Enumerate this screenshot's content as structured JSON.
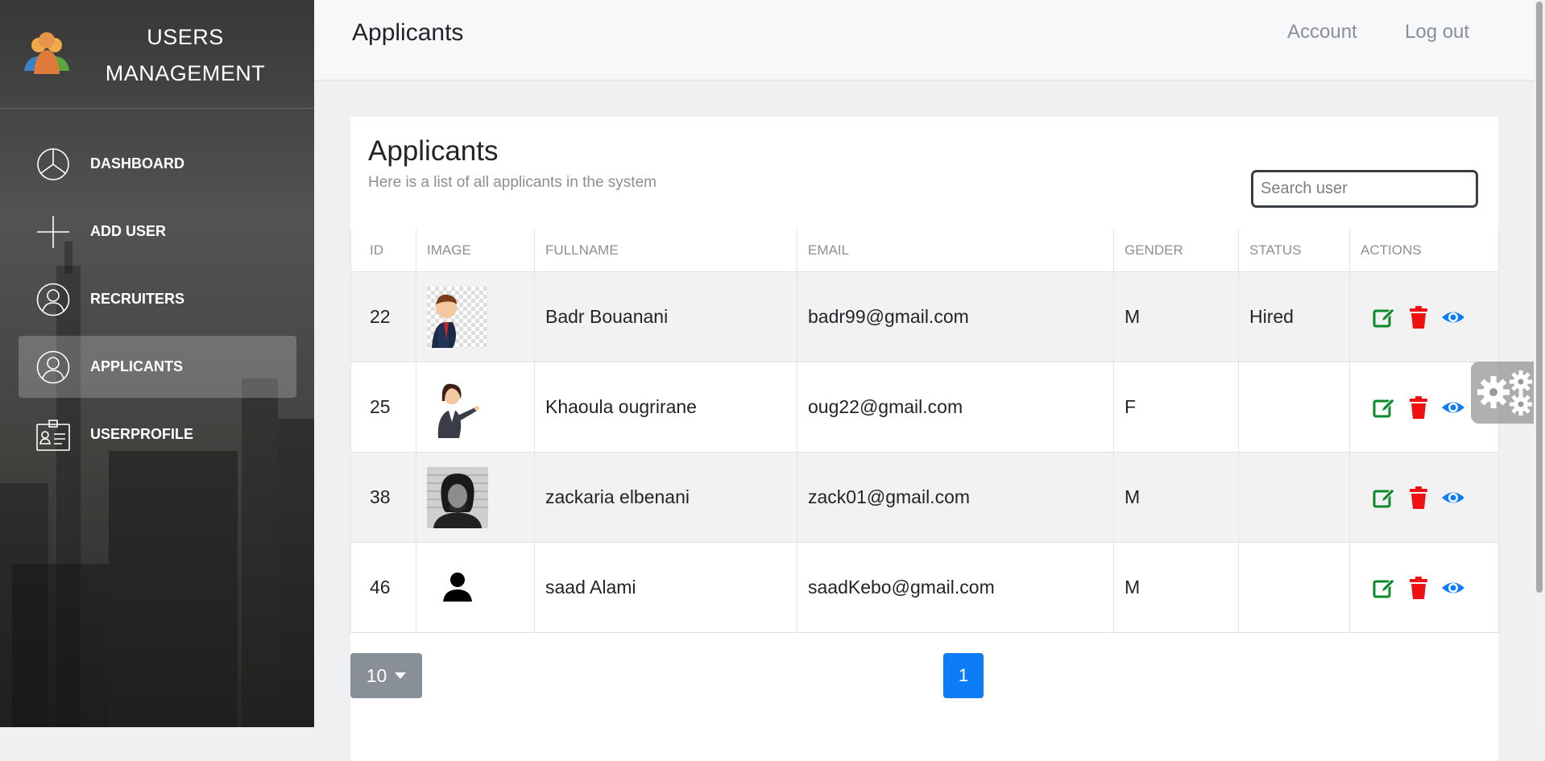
{
  "sidebar": {
    "brand_line1": "USERS",
    "brand_line2": "MANAGEMENT",
    "logo_icon": "users-group-icon",
    "items": [
      {
        "label": "DASHBOARD",
        "icon": "pie-chart-icon",
        "active": false
      },
      {
        "label": "ADD USER",
        "icon": "plus-icon",
        "active": false
      },
      {
        "label": "RECRUITERS",
        "icon": "user-circle-icon",
        "active": false
      },
      {
        "label": "APPLICANTS",
        "icon": "user-circle-icon",
        "active": true
      },
      {
        "label": "USERPROFILE",
        "icon": "id-card-icon",
        "active": false
      }
    ]
  },
  "topbar": {
    "title": "Applicants",
    "account": "Account",
    "logout": "Log out"
  },
  "card": {
    "heading": "Applicants",
    "subheading": "Here is a list of all applicants in the system",
    "search_placeholder": "Search user"
  },
  "table": {
    "columns": [
      "ID",
      "IMAGE",
      "FULLNAME",
      "EMAIL",
      "GENDER",
      "STATUS",
      "ACTIONS"
    ],
    "rows": [
      {
        "id": "22",
        "image": "cartoon-businessman-avatar",
        "fullname": "Badr Bouanani",
        "email": "badr99@gmail.com",
        "gender": "M",
        "status": "Hired"
      },
      {
        "id": "25",
        "image": "cartoon-businesswoman-avatar",
        "fullname": "Khaoula ougrirane",
        "email": "oug22@gmail.com",
        "gender": "F",
        "status": ""
      },
      {
        "id": "38",
        "image": "photo-man-avatar",
        "fullname": "zackaria elbenani",
        "email": "zack01@gmail.com",
        "gender": "M",
        "status": ""
      },
      {
        "id": "46",
        "image": "default-person-avatar",
        "fullname": "saad Alami",
        "email": "saadKebo@gmail.com",
        "gender": "M",
        "status": ""
      }
    ]
  },
  "pagination": {
    "page_size": "10",
    "current_page": "1"
  },
  "colors": {
    "edit": "#0a8a2a",
    "delete": "#ee1111",
    "view": "#0d7df7",
    "active_page": "#0d7df7"
  }
}
